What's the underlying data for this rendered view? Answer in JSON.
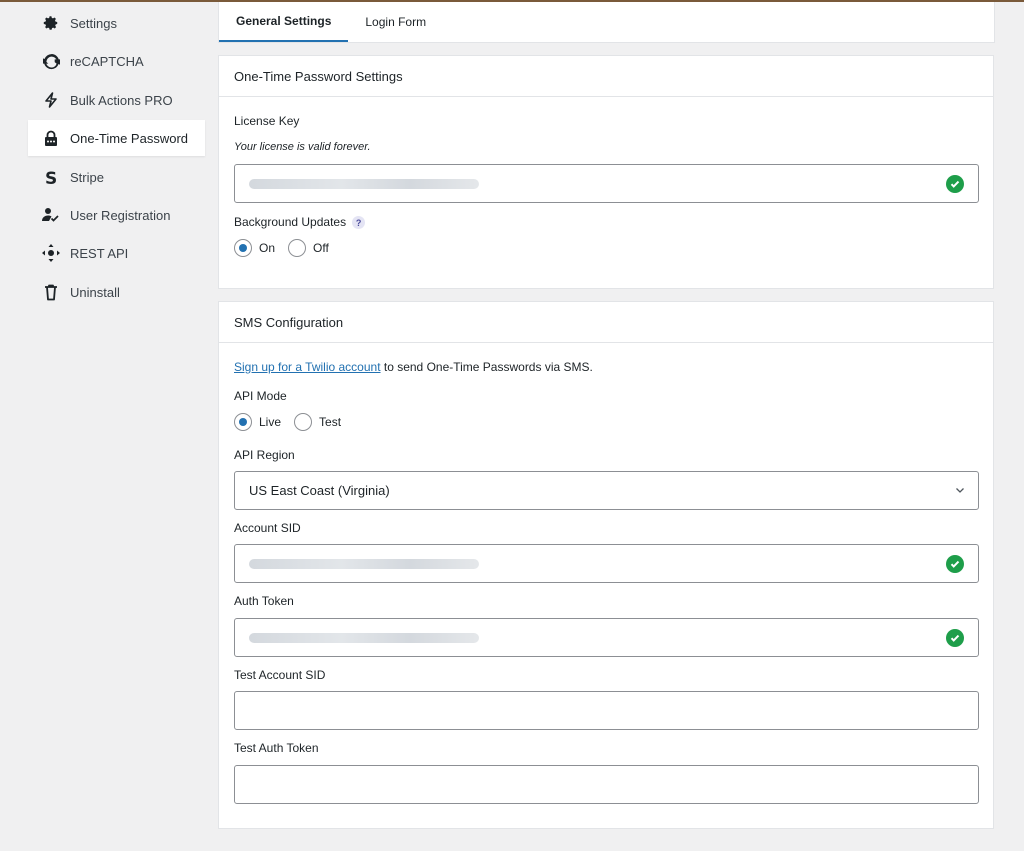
{
  "sidebar": {
    "items": [
      {
        "label": "Settings",
        "icon": "gear-icon"
      },
      {
        "label": "reCAPTCHA",
        "icon": "recaptcha-icon"
      },
      {
        "label": "Bulk Actions PRO",
        "icon": "lightning-icon"
      },
      {
        "label": "One-Time Password",
        "icon": "lock-icon",
        "active": true
      },
      {
        "label": "Stripe",
        "icon": "stripe-icon"
      },
      {
        "label": "User Registration",
        "icon": "user-check-icon"
      },
      {
        "label": "REST API",
        "icon": "api-icon"
      },
      {
        "label": "Uninstall",
        "icon": "trash-icon"
      }
    ]
  },
  "tabs": [
    {
      "label": "General Settings",
      "active": true
    },
    {
      "label": "Login Form",
      "active": false
    }
  ],
  "otp_card": {
    "title": "One-Time Password Settings",
    "license_label": "License Key",
    "license_note": "Your license is valid forever.",
    "bg_updates_label": "Background Updates",
    "help_glyph": "?",
    "bg_updates_options": [
      "On",
      "Off"
    ],
    "bg_updates_selected": "On"
  },
  "sms_card": {
    "title": "SMS Configuration",
    "signup_link": "Sign up for a Twilio account",
    "signup_text": " to send One-Time Passwords via SMS.",
    "api_mode_label": "API Mode",
    "api_mode_options": [
      "Live",
      "Test"
    ],
    "api_mode_selected": "Live",
    "api_region_label": "API Region",
    "api_region_value": "US East Coast (Virginia)",
    "account_sid_label": "Account SID",
    "auth_token_label": "Auth Token",
    "test_account_sid_label": "Test Account SID",
    "test_auth_token_label": "Test Auth Token",
    "test_account_sid_value": "",
    "test_auth_token_value": ""
  },
  "colors": {
    "accent": "#2271b1",
    "success": "#1e9e4a"
  }
}
